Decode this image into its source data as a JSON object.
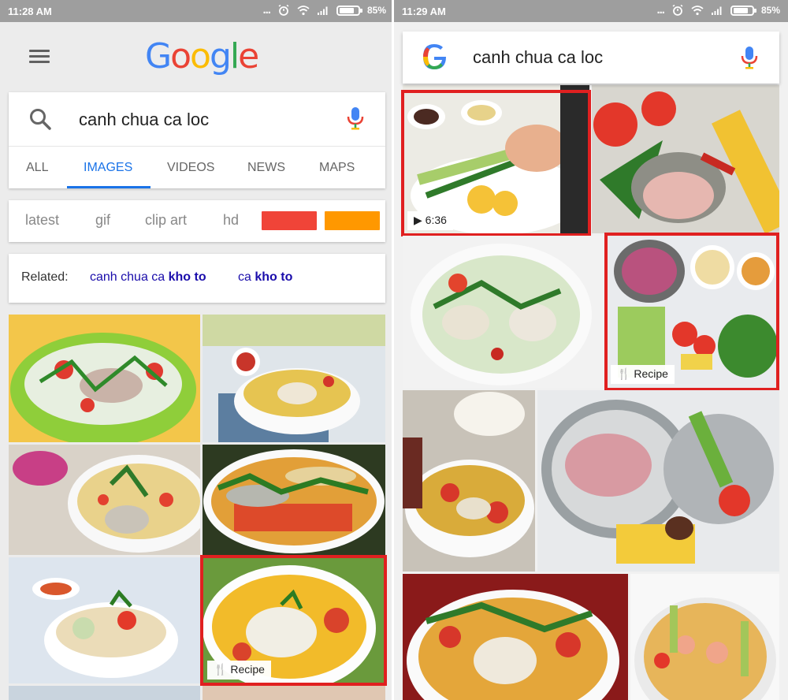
{
  "left": {
    "status": {
      "time": "11:28 AM",
      "dots": "...",
      "battery_pct": "85%"
    },
    "logo": "Google",
    "search": {
      "query": "canh chua ca loc"
    },
    "tabs": [
      "ALL",
      "IMAGES",
      "VIDEOS",
      "NEWS",
      "MAPS"
    ],
    "active_tab": "IMAGES",
    "chips": [
      "latest",
      "gif",
      "clip art",
      "hd"
    ],
    "chip_colors": [
      "#f04438",
      "#ff9800"
    ],
    "related": {
      "label": "Related:",
      "link1_plain": "canh chua ca ",
      "link1_bold": "kho to",
      "link2_plain": "ca ",
      "link2_bold": "kho to"
    },
    "result_badge": "Recipe"
  },
  "right": {
    "status": {
      "time": "11:29 AM",
      "dots": "...",
      "battery_pct": "85%"
    },
    "search": {
      "query": "canh chua ca loc"
    },
    "video_badge": "6:36",
    "result_badge": "Recipe"
  },
  "colors": {
    "highlight": "#e02020",
    "link": "#1a0dab",
    "active_tab": "#1a73e8",
    "status_bar": "#9e9e9e"
  }
}
